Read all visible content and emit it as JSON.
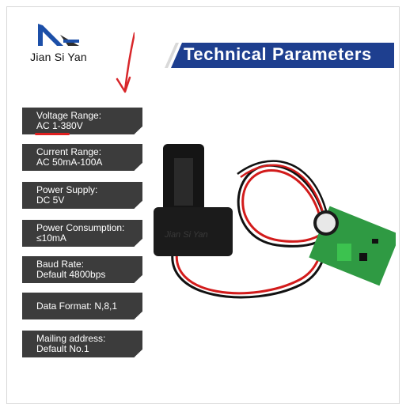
{
  "logo": {
    "text": "Jian Si Yan",
    "mark_colors": [
      "#1c4fa8",
      "#2d2d2d"
    ]
  },
  "banner": {
    "title": "Technical Parameters",
    "bg_color": "#1e3f8f",
    "accent": "#d9d9d9"
  },
  "annotation": {
    "arrow_color": "#d8262a",
    "underline_color": "#e02020"
  },
  "params": [
    {
      "line1": "Voltage Range:",
      "line2": "AC 1-380V"
    },
    {
      "line1": "Current Range:",
      "line2": "AC 50mA-100A"
    },
    {
      "line1": "Power Supply:",
      "line2": "DC 5V"
    },
    {
      "line1": "Power Consumption:",
      "line2": "≤10mA"
    },
    {
      "line1": "Baud Rate:",
      "line2": "Default 4800bps"
    },
    {
      "line1": "Data Format: N,8,1",
      "line2": ""
    },
    {
      "line1": "Mailing address:",
      "line2": "Default No.1"
    }
  ],
  "product": {
    "sensor_label": "Jian Si Yan",
    "wire_colors": [
      "#111111",
      "#d21b1b"
    ],
    "pcb_color": "#2f9a43"
  }
}
